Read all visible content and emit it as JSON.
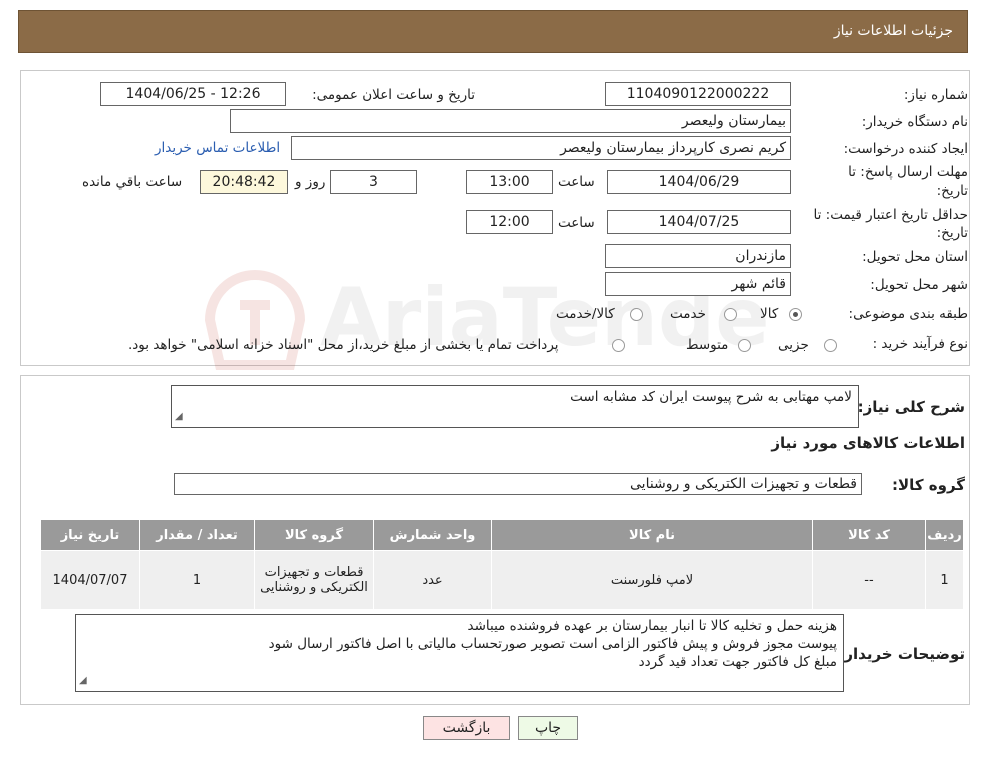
{
  "header": {
    "title": "جزئیات اطلاعات نیاز"
  },
  "form": {
    "need_number_label": "شماره نیاز:",
    "need_number": "1104090122000222",
    "announce_label": "تاریخ و ساعت اعلان عمومی:",
    "announce_value": "1404/06/25 - 12:26",
    "buyer_org_label": "نام دستگاه خریدار:",
    "buyer_org": "بیمارستان ولیعصر",
    "creator_label": "ایجاد کننده درخواست:",
    "creator": "کریم نصری کارپرداز بیمارستان ولیعصر",
    "contact_link": "اطلاعات تماس خریدار",
    "deadline_label_1": "مهلت ارسال پاسخ: تا",
    "deadline_label_2": "تاریخ:",
    "deadline_date": "1404/06/29",
    "hour_label": "ساعت",
    "deadline_time": "13:00",
    "days_value": "3",
    "days_label": "روز و",
    "remaining_time": "20:48:42",
    "remaining_label": "ساعت باقي مانده",
    "validity_label_1": "حداقل تاریخ اعتبار قیمت: تا",
    "validity_label_2": "تاریخ:",
    "validity_date": "1404/07/25",
    "validity_hour_label": "ساعت",
    "validity_time": "12:00",
    "province_label": "استان محل تحویل:",
    "province": "مازندران",
    "city_label": "شهر محل تحویل:",
    "city": "قائم شهر",
    "category_label": "طبقه بندی موضوعی:",
    "category_options": [
      "کالا",
      "خدمت",
      "کالا/خدمت"
    ],
    "category_selected": "کالا",
    "process_label": "نوع فرآیند خرید :",
    "process_options": [
      "جزیی",
      "متوسط"
    ],
    "process_note": "پرداخت تمام یا بخشی از مبلغ خرید،از محل \"اسناد خزانه اسلامی\" خواهد بود."
  },
  "summary": {
    "desc_label": "شرح کلی نیاز:",
    "desc_value": "لامپ مهتابی به شرح پیوست   ایران کد مشابه است",
    "items_title": "اطلاعات کالاهای مورد نیاز",
    "group_label": "گروه کالا:",
    "group_value": "قطعات و تجهیزات الکتریکی و روشنایی"
  },
  "table": {
    "headers": [
      "ردیف",
      "کد کالا",
      "نام کالا",
      "واحد شمارش",
      "گروه کالا",
      "تعداد / مقدار",
      "تاریخ نیاز"
    ],
    "rows": [
      [
        "1",
        "--",
        "لامپ فلورسنت",
        "عدد",
        "قطعات و تجهیزات الکتریکی و روشنایی",
        "1",
        "1404/07/07"
      ]
    ]
  },
  "notes": {
    "label": "توضیحات خریدار:",
    "line1": "هزینه حمل و تخلیه کالا تا انبار بیمارستان بر عهده فروشنده میباشد",
    "line2": "پیوست مجوز فروش و پیش فاکتور الزامی است  تصویر صورتحساب مالیاتی با اصل فاکتور ارسال شود",
    "line3": "مبلغ کل فاکتور جهت تعداد قید گردد"
  },
  "buttons": {
    "print": "چاپ",
    "back": "بازگشت"
  },
  "watermark": {
    "text": "AriaTender.neT"
  },
  "colors": {
    "header": "#8b6b47",
    "table_header": "#9a9a9a",
    "print_btn": "#eefae6",
    "back_btn": "#fde3e3"
  }
}
